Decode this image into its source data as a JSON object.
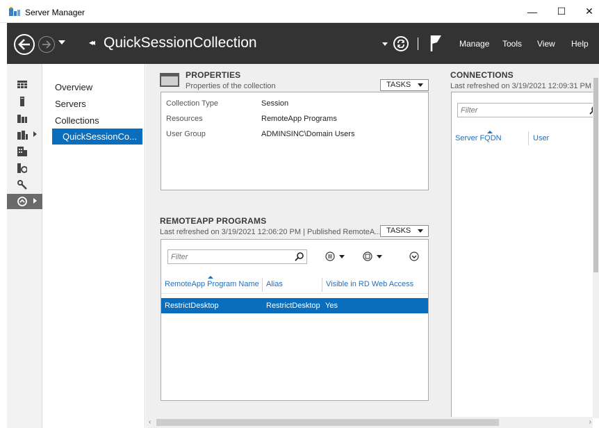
{
  "window": {
    "title": "Server Manager",
    "minimize": "—",
    "maximize": "☐",
    "close": "✕"
  },
  "header": {
    "breadcrumb_arrows": "◂◂",
    "breadcrumb": "QuickSessionCollection",
    "menus": [
      "Manage",
      "Tools",
      "View",
      "Help"
    ]
  },
  "rail": {
    "icons": [
      "dashboard-icon",
      "local-server-icon",
      "all-servers-icon",
      "file-storage-icon",
      "roles-icon",
      "iis-icon",
      "tools-icon",
      "remote-desktop-icon"
    ]
  },
  "tree": {
    "items": [
      "Overview",
      "Servers",
      "Collections"
    ],
    "selected": "QuickSessionCo..."
  },
  "properties": {
    "title": "PROPERTIES",
    "subtitle": "Properties of the collection",
    "tasks_label": "TASKS",
    "rows": [
      {
        "label": "Collection Type",
        "value": "Session"
      },
      {
        "label": "Resources",
        "value": "RemoteApp Programs"
      },
      {
        "label": "User Group",
        "value": "ADMINSINC\\Domain Users"
      }
    ]
  },
  "remoteapp": {
    "title": "REMOTEAPP PROGRAMS",
    "subtitle": "Last refreshed on 3/19/2021 12:06:20 PM | Published RemoteA...",
    "tasks_label": "TASKS",
    "filter_placeholder": "Filter",
    "columns": [
      "RemoteApp Program Name",
      "Alias",
      "Visible in RD Web Access"
    ],
    "rows": [
      {
        "name": "RestrictDesktop",
        "alias": "RestrictDesktop",
        "visible": "Yes"
      }
    ]
  },
  "connections": {
    "title": "CONNECTIONS",
    "subtitle": "Last refreshed on 3/19/2021 12:09:31 PM |",
    "filter_placeholder": "Filter",
    "columns": [
      "Server FQDN",
      "User"
    ]
  },
  "colors": {
    "header_bg": "#333333",
    "selection": "#0a6ebd",
    "link": "#1d6fbf",
    "panel_bg": "#efefef"
  }
}
